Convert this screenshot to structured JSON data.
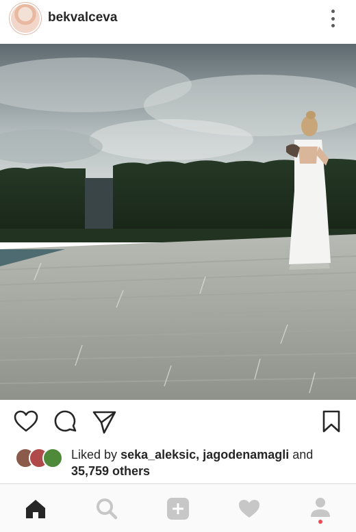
{
  "post": {
    "username": "bekvalceva"
  },
  "likes": {
    "prefix": "Liked by",
    "user1": "seka_aleksic,",
    "user2": "jagodenamagli",
    "conjunction": "and",
    "others": "35,759 others"
  },
  "icons": {
    "more": "more-options-icon",
    "like": "heart-outline-icon",
    "comment": "comment-bubble-icon",
    "share": "send-plane-icon",
    "save": "bookmark-icon",
    "home": "home-icon",
    "search": "search-icon",
    "add": "add-post-icon",
    "activity": "heart-filled-icon",
    "profile": "profile-icon"
  },
  "colors": {
    "notification_dot": "#ed4956",
    "inactive_icon": "#c7c7c7",
    "active_icon": "#262626"
  }
}
